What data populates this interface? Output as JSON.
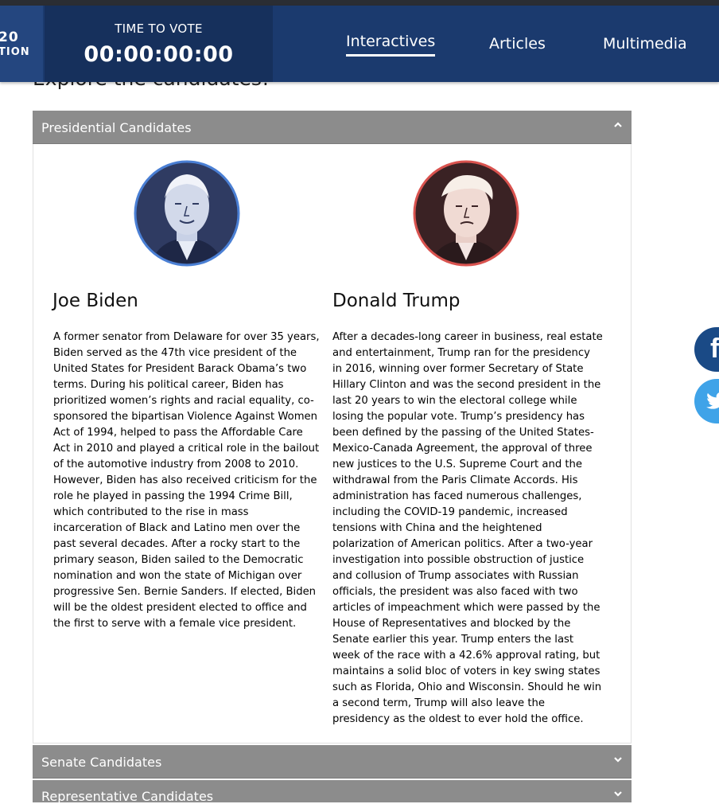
{
  "header": {
    "logo_line1": "20",
    "logo_line2": "TION",
    "countdown_label": "TIME TO VOTE",
    "countdown_value": "00:00:00:00",
    "nav": [
      "Interactives",
      "Articles",
      "Multimedia"
    ]
  },
  "page": {
    "heading": "Explore the candidates!"
  },
  "accordion": {
    "presidential": {
      "title": "Presidential Candidates",
      "candidates": [
        {
          "name": "Joe Biden",
          "bio": "A former senator from Delaware for over 35 years, Biden served as the 47th vice president of the United States for President Barack Obama’s two terms. During his political career, Biden has prioritized women’s rights and racial equality, co-sponsored the bipartisan Violence Against Women Act of 1994, helped to pass the Affordable Care Act in 2010 and played a critical role in the bailout of the automotive industry from 2008 to 2010. However, Biden has also received criticism for the role he played in passing the 1994 Crime Bill, which contributed to the rise in mass incarceration of Black and Latino men over the past several decades. After a rocky start to the primary season, Biden sailed to the Democratic nomination and won the state of Michigan over progressive Sen. Bernie Sanders. If elected, Biden will be the oldest president elected to office and the first to serve with a female vice president."
        },
        {
          "name": "Donald Trump",
          "bio": "After a decades-long career in business, real estate and entertainment, Trump ran for the presidency in 2016, winning over former Secretary of State Hillary Clinton and was the second president in the last 20 years to win the electoral college while losing the popular vote. Trump’s presidency has been defined by the passing of the United States-Mexico-Canada Agreement, the approval of three new justices to the U.S. Supreme Court and the withdrawal from the Paris Climate Accords. His administration has faced numerous challenges, including the COVID-19 pandemic, increased tensions with China and the heightened polarization of American politics. After a two-year investigation into possible obstruction of justice and collusion of Trump associates with Russian officials, the president was also faced with two articles of impeachment which were passed by the House of Representatives and blocked by the Senate earlier this year. Trump enters the last week of the race with a 42.6% approval rating, but maintains a solid bloc of voters in key swing states such as Florida, Ohio and Wisconsin. Should he win a second term, Trump will also leave the presidency as the oldest to ever hold the office."
        }
      ]
    },
    "senate": {
      "title": "Senate Candidates"
    },
    "representative": {
      "title": "Representative Candidates"
    }
  },
  "social": {
    "facebook_glyph": "f",
    "twitter_icon": "twitter-icon"
  },
  "colors": {
    "header_bg": "#1b3a6e",
    "accordion_header": "#8c8c8c",
    "biden_ring": "#4a7fd4",
    "trump_ring": "#d9534f",
    "facebook": "#1a4a86",
    "twitter": "#3fa3e8"
  }
}
